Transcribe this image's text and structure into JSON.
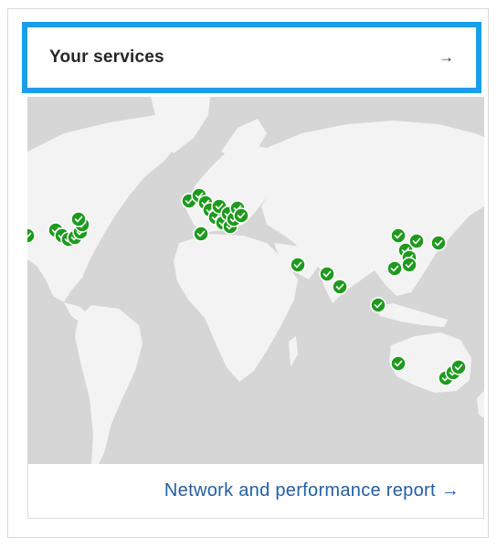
{
  "card": {
    "title": "Your services",
    "title_arrow": "→",
    "report_link": "Network and performance report →"
  },
  "map": {
    "ocean_color": "#d6d6d6",
    "land_color": "#f3f3f3",
    "marker_color": "#1f9a1f",
    "marker_icon": "check-icon"
  },
  "colors": {
    "accent_border": "#1a9ee8",
    "link": "#1f5fa8"
  }
}
